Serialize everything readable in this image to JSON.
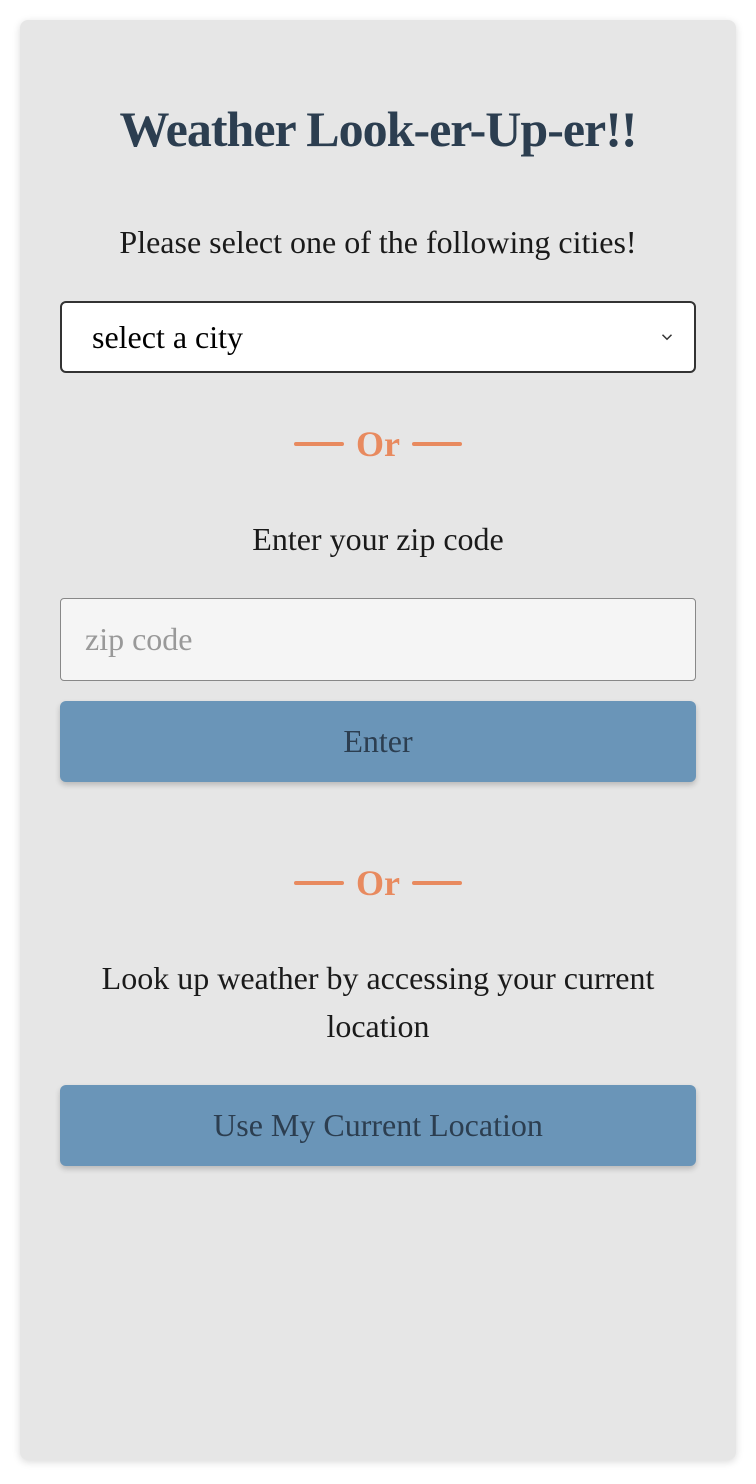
{
  "title": "Weather Look-er-Up-er!!",
  "city_section": {
    "prompt": "Please select one of the following cities!",
    "select_placeholder": "select a city"
  },
  "divider_text": "Or",
  "zip_section": {
    "prompt": "Enter your zip code",
    "placeholder": "zip code",
    "button_label": "Enter"
  },
  "location_section": {
    "prompt": "Look up weather by accessing your current location",
    "button_label": "Use My Current Location"
  }
}
